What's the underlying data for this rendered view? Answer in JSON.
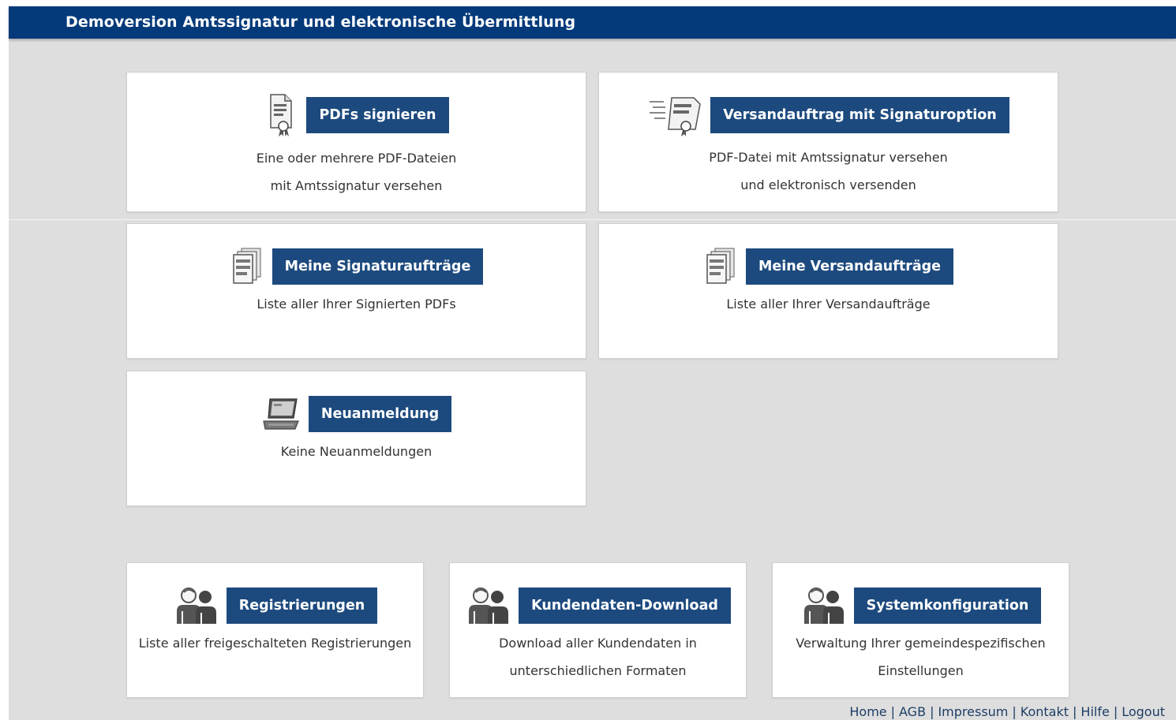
{
  "header": {
    "title": "Demoversion Amtssignatur und elektronische Übermittlung"
  },
  "cards": {
    "pdfs_signieren": {
      "button": "PDFs signieren",
      "icon": "pdf-sign-icon",
      "desc": [
        "Eine oder mehrere PDF-Dateien",
        "mit Amtssignatur versehen"
      ]
    },
    "versandauftrag": {
      "button": "Versandauftrag mit Signaturoption",
      "icon": "send-document-icon",
      "desc": [
        "PDF-Datei mit Amtssignatur versehen",
        "und elektronisch versenden"
      ]
    },
    "signaturauftraege": {
      "button": "Meine Signaturaufträge",
      "icon": "document-stack-icon",
      "desc": [
        "Liste aller Ihrer Signierten PDFs"
      ]
    },
    "versandauftraege": {
      "button": "Meine Versandaufträge",
      "icon": "document-stack-icon",
      "desc": [
        "Liste aller Ihrer Versandaufträge"
      ]
    },
    "neuanmeldung": {
      "button": "Neuanmeldung",
      "icon": "laptop-icon",
      "desc": [
        "Keine Neuanmeldungen"
      ]
    },
    "registrierungen": {
      "button": "Registrierungen",
      "icon": "users-icon",
      "desc": [
        "Liste aller freigeschalteten Registrierungen"
      ]
    },
    "kundendaten": {
      "button": "Kundendaten-Download",
      "icon": "users-icon",
      "desc": [
        "Download aller Kundendaten in",
        "unterschiedlichen Formaten"
      ]
    },
    "systemkonfiguration": {
      "button": "Systemkonfiguration",
      "icon": "users-icon",
      "desc": [
        "Verwaltung Ihrer gemeindespezifischen",
        "Einstellungen"
      ]
    }
  },
  "footer": {
    "links": [
      "Home",
      "AGB",
      "Impressum",
      "Kontakt",
      "Hilfe",
      "Logout"
    ],
    "separator": "|"
  },
  "colors": {
    "header_bg": "#043a7a",
    "button_bg": "#1d4a7e",
    "page_bg": "#dedede"
  }
}
